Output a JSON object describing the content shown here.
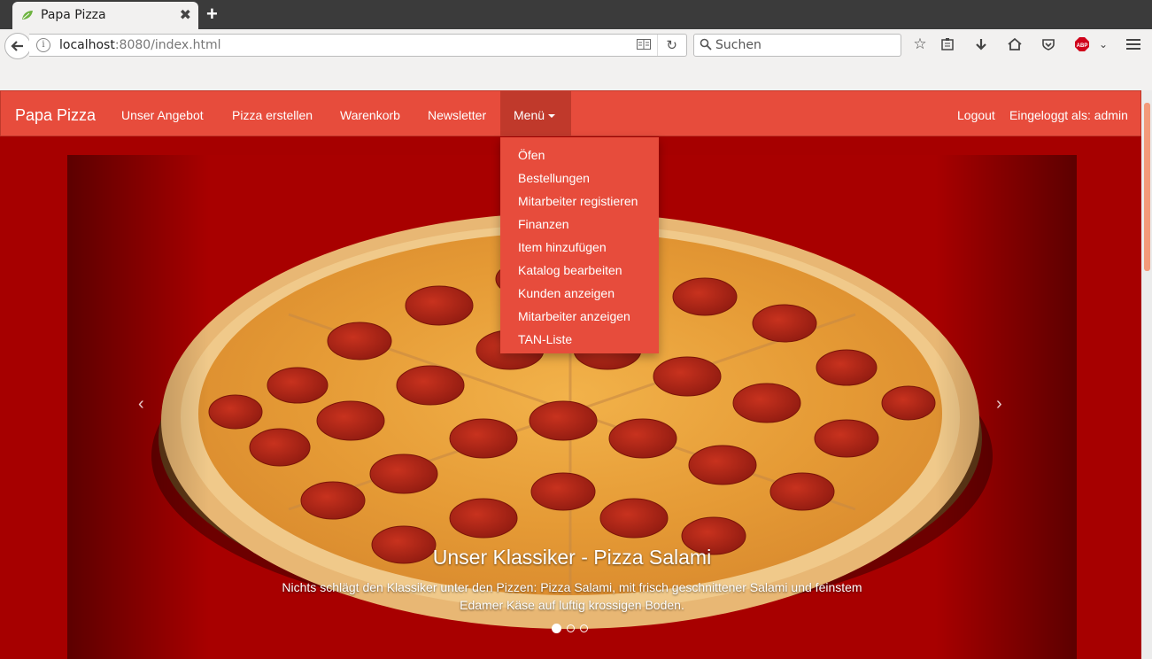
{
  "browser": {
    "tab_title": "Papa Pizza",
    "tab_close": "✖",
    "new_tab": "+",
    "url_host": "localhost",
    "url_rest": ":8080/index.html",
    "search_placeholder": "Suchen",
    "abp_label": "ABP"
  },
  "nav": {
    "brand": "Papa Pizza",
    "items": [
      "Unser Angebot",
      "Pizza erstellen",
      "Warenkorb",
      "Newsletter"
    ],
    "menu_label": "Menü",
    "logout": "Logout",
    "logged_in": "Eingeloggt als: admin"
  },
  "dropdown": {
    "items": [
      "Öfen",
      "Bestellungen",
      "Mitarbeiter registieren",
      "Finanzen",
      "Item hinzufügen",
      "Katalog bearbeiten",
      "Kunden anzeigen",
      "Mitarbeiter anzeigen",
      "TAN-Liste"
    ]
  },
  "carousel": {
    "title": "Unser Klassiker - Pizza Salami",
    "text": "Nichts schlägt den Klassiker unter den Pizzen: Pizza Salami, mit frisch geschnittener Salami und feinstem Edamer Käse auf luftig krossigen Boden.",
    "prev": "‹",
    "next": "›",
    "active_slide": 1,
    "slide_count": 3
  },
  "colors": {
    "navbar": "#e74c3c",
    "navbar_active": "#c0392b",
    "background": "#a60000"
  }
}
